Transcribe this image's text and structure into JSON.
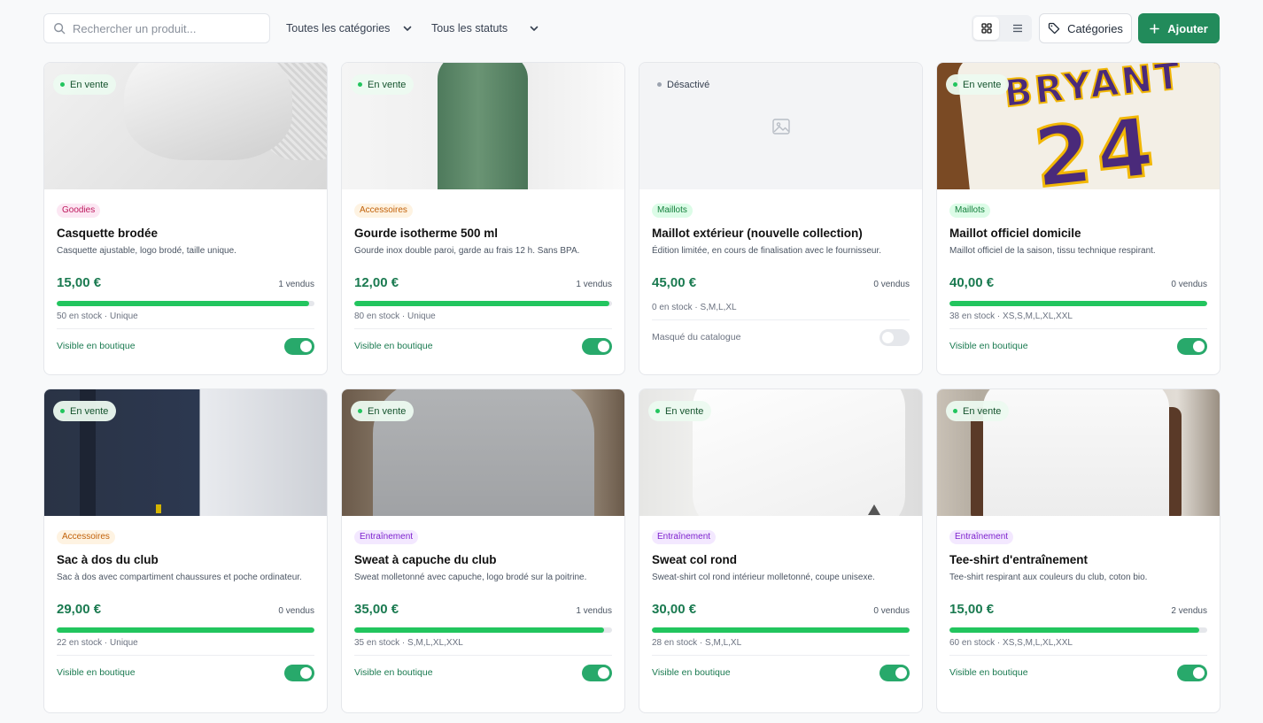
{
  "toolbar": {
    "search_placeholder": "Rechercher un produit...",
    "category_filter": "Toutes les catégories",
    "status_filter": "Tous les statuts",
    "categories_button": "Catégories",
    "add_button": "Ajouter"
  },
  "products": [
    {
      "status": "En vente",
      "badge": "Goodies",
      "badge_bg": "#fce7f3",
      "badge_color": "#be185d",
      "title": "Casquette brodée",
      "description": "Casquette ajustable, logo brodé, taille unique.",
      "price": "15,00 €",
      "sold": "1 vendus",
      "stock_fraction": 0.98,
      "stock": "50 en stock · Unique",
      "visibility": "Visible en boutique",
      "visible": true
    },
    {
      "status": "En vente",
      "badge": "Accessoires",
      "badge_bg": "#fef3e2",
      "badge_color": "#c2620a",
      "title": "Gourde isotherme 500 ml",
      "description": "Gourde inox double paroi, garde au frais 12 h. Sans BPA.",
      "price": "12,00 €",
      "sold": "1 vendus",
      "stock_fraction": 0.99,
      "stock": "80 en stock · Unique",
      "visibility": "Visible en boutique",
      "visible": true
    },
    {
      "status": "Désactivé",
      "badge": "Maillots",
      "badge_bg": "#dcfce7",
      "badge_color": "#15803d",
      "title": "Maillot extérieur (nouvelle collection)",
      "description": "Édition limitée, en cours de finalisation avec le fournisseur.",
      "price": "45,00 €",
      "sold": "0 vendus",
      "stock_fraction": 0,
      "stock": "0 en stock · S,M,L,XL",
      "visibility": "Masqué du catalogue",
      "visible": false
    },
    {
      "status": "En vente",
      "badge": "Maillots",
      "badge_bg": "#dcfce7",
      "badge_color": "#15803d",
      "title": "Maillot officiel domicile",
      "description": "Maillot officiel de la saison, tissu technique respirant.",
      "price": "40,00 €",
      "sold": "0 vendus",
      "stock_fraction": 1,
      "stock": "38 en stock · XS,S,M,L,XL,XXL",
      "visibility": "Visible en boutique",
      "visible": true
    },
    {
      "status": "En vente",
      "badge": "Accessoires",
      "badge_bg": "#fef3e2",
      "badge_color": "#c2620a",
      "title": "Sac à dos du club",
      "description": "Sac à dos avec compartiment chaussures et poche ordinateur.",
      "price": "29,00 €",
      "sold": "0 vendus",
      "stock_fraction": 1,
      "stock": "22 en stock · Unique",
      "visibility": "Visible en boutique",
      "visible": true
    },
    {
      "status": "En vente",
      "badge": "Entraînement",
      "badge_bg": "#f3e8ff",
      "badge_color": "#7e22ce",
      "title": "Sweat à capuche du club",
      "description": "Sweat molletonné avec capuche, logo brodé sur la poitrine.",
      "price": "35,00 €",
      "sold": "1 vendus",
      "stock_fraction": 0.97,
      "stock": "35 en stock · S,M,L,XL,XXL",
      "visibility": "Visible en boutique",
      "visible": true
    },
    {
      "status": "En vente",
      "badge": "Entraînement",
      "badge_bg": "#f3e8ff",
      "badge_color": "#7e22ce",
      "title": "Sweat col rond",
      "description": "Sweat-shirt col rond intérieur molletonné, coupe unisexe.",
      "price": "30,00 €",
      "sold": "0 vendus",
      "stock_fraction": 1,
      "stock": "28 en stock · S,M,L,XL",
      "visibility": "Visible en boutique",
      "visible": true
    },
    {
      "status": "En vente",
      "badge": "Entraînement",
      "badge_bg": "#f3e8ff",
      "badge_color": "#7e22ce",
      "title": "Tee-shirt d'entraînement",
      "description": "Tee-shirt respirant aux couleurs du club, coton bio.",
      "price": "15,00 €",
      "sold": "2 vendus",
      "stock_fraction": 0.97,
      "stock": "60 en stock · XS,S,M,L,XL,XXL",
      "visibility": "Visible en boutique",
      "visible": true
    }
  ],
  "colors": {
    "primary": "#228b5b",
    "price": "#1a7a50",
    "stock_bar": "#22c55e",
    "toggle_on": "#28a96b"
  },
  "jersey_print": {
    "name": "BRYANT",
    "number": "24"
  }
}
